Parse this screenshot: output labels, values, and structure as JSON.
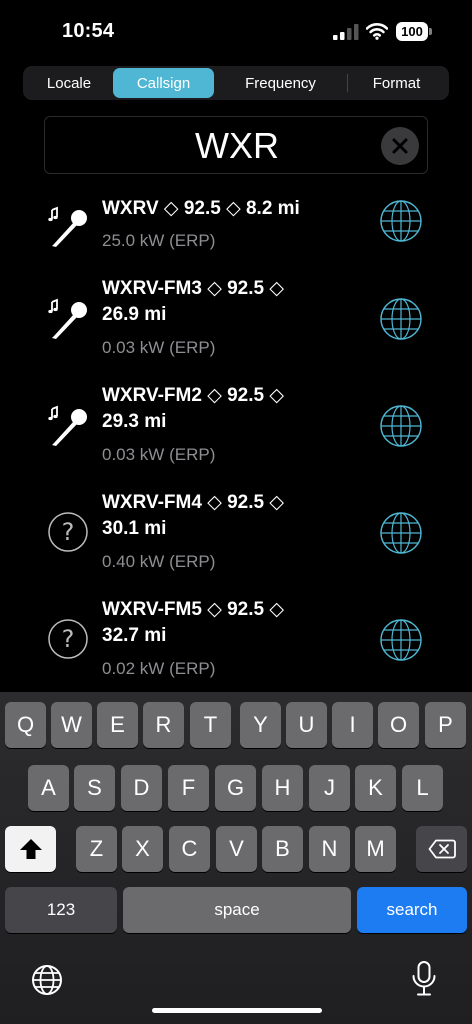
{
  "status_bar": {
    "time": "10:54",
    "battery": "100"
  },
  "tabs": [
    {
      "label": "Locale",
      "selected": false
    },
    {
      "label": "Callsign",
      "selected": true
    },
    {
      "label": "Frequency",
      "selected": false
    },
    {
      "label": "Format",
      "selected": false
    }
  ],
  "search": {
    "value": "WXR"
  },
  "stations": [
    {
      "title_line1": "WXRV ◇ 92.5 ◇ 8.2 mi",
      "title_line2": "",
      "power": "25.0 kW (ERP)",
      "icon": "music-microphone-icon"
    },
    {
      "title_line1": "WXRV-FM3 ◇ 92.5 ◇",
      "title_line2": "26.9 mi",
      "power": "0.03 kW (ERP)",
      "icon": "music-microphone-icon"
    },
    {
      "title_line1": "WXRV-FM2 ◇ 92.5 ◇",
      "title_line2": "29.3 mi",
      "power": "0.03 kW (ERP)",
      "icon": "music-microphone-icon"
    },
    {
      "title_line1": "WXRV-FM4 ◇ 92.5 ◇",
      "title_line2": "30.1 mi",
      "power": "0.40 kW (ERP)",
      "icon": "question-mark-circle-icon"
    },
    {
      "title_line1": "WXRV-FM5 ◇ 92.5 ◇",
      "title_line2": "32.7 mi",
      "power": "0.02 kW (ERP)",
      "icon": "question-mark-circle-icon"
    }
  ],
  "keyboard": {
    "row1": [
      "Q",
      "W",
      "E",
      "R",
      "T",
      "Y",
      "U",
      "I",
      "O",
      "P"
    ],
    "row2": [
      "A",
      "S",
      "D",
      "F",
      "G",
      "H",
      "J",
      "K",
      "L"
    ],
    "row3": [
      "Z",
      "X",
      "C",
      "V",
      "B",
      "N",
      "M"
    ],
    "numbers_label": "123",
    "space_label": "space",
    "search_label": "search"
  },
  "colors": {
    "accent": "#4fb7d3",
    "search_key": "#1e7cf2",
    "secondary_text": "#8e8e93"
  }
}
